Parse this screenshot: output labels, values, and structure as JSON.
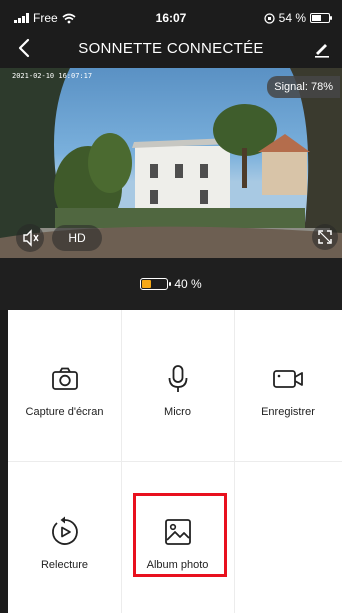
{
  "status_bar": {
    "carrier": "Free",
    "time": "16:07",
    "battery_percent": "54 %"
  },
  "nav": {
    "title": "SONNETTE CONNECTÉE"
  },
  "camera": {
    "timestamp": "2021-02-10 16:07:17",
    "signal": "Signal: 78%",
    "quality": "HD"
  },
  "battery": {
    "level_text": "40 %",
    "level": 0.4,
    "color": "#f6a816"
  },
  "actions": [
    {
      "label": "Capture d'écran",
      "icon": "camera-icon"
    },
    {
      "label": "Micro",
      "icon": "microphone-icon"
    },
    {
      "label": "Enregistrer",
      "icon": "video-camera-icon"
    },
    {
      "label": "Relecture",
      "icon": "replay-icon"
    },
    {
      "label": "Album photo",
      "icon": "image-icon",
      "highlighted": true
    }
  ],
  "colors": {
    "highlight": "#e8101e",
    "background": "#1c1c1c"
  }
}
